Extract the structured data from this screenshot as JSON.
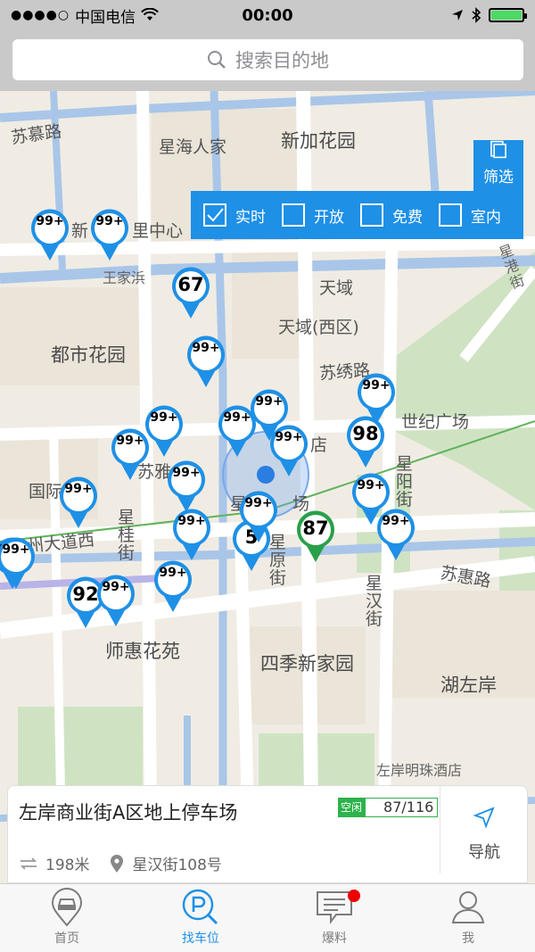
{
  "status_bar": {
    "carrier": "中国电信",
    "time": "00:00"
  },
  "search": {
    "placeholder": "搜索目的地"
  },
  "filter": {
    "button_label": "筛选",
    "options": [
      {
        "label": "实时",
        "checked": true
      },
      {
        "label": "开放",
        "checked": false
      },
      {
        "label": "免费",
        "checked": false
      },
      {
        "label": "室内",
        "checked": false
      }
    ]
  },
  "map_labels": {
    "sumu_road": "苏慕路",
    "xinghai": "星海人家",
    "xinjia": "新加花园",
    "xinli_center": "新",
    "xinli_center2": "里中心",
    "wangjiabang": "王家浜",
    "tianyu": "天域",
    "tianyu_west": "天域(西区)",
    "dushi": "都市花园",
    "suxiu_road": "苏绣路",
    "century_square": "世纪广场",
    "guoji": "国际",
    "suya": "苏雅",
    "xing_square": "星",
    "xing_square2": "场",
    "suzhou_ave": "州大道西",
    "xinggui_st": "星桂街",
    "xingyang_st": "星阳街",
    "xingyuan_st": "星原街",
    "suhui_road": "苏惠路",
    "xinghan_st": "星汉街",
    "shihui": "师惠花苑",
    "siji": "四季新家园",
    "huzuoan": "湖左岸",
    "hotel": "左岸明珠酒店",
    "dian": "店",
    "huxi": "湖",
    "xingang": "星港街",
    "zhong": "中"
  },
  "pins": [
    {
      "label": "99+",
      "color": "#1e90e6"
    },
    {
      "label": "99+",
      "color": "#1e90e6"
    },
    {
      "label": "67",
      "color": "#1e90e6"
    },
    {
      "label": "99+",
      "color": "#1e90e6"
    },
    {
      "label": "99+",
      "color": "#1e90e6"
    },
    {
      "label": "99+",
      "color": "#1e90e6"
    },
    {
      "label": "99+",
      "color": "#1e90e6"
    },
    {
      "label": "99+",
      "color": "#1e90e6"
    },
    {
      "label": "99+",
      "color": "#1e90e6"
    },
    {
      "label": "98",
      "color": "#1e90e6"
    },
    {
      "label": "99+",
      "color": "#1e90e6"
    },
    {
      "label": "99+",
      "color": "#1e90e6"
    },
    {
      "label": "99+",
      "color": "#1e90e6"
    },
    {
      "label": "99+",
      "color": "#1e90e6"
    },
    {
      "label": "99+",
      "color": "#1e90e6"
    },
    {
      "label": "5",
      "color": "#1e90e6"
    },
    {
      "label": "99+",
      "color": "#1e90e6"
    },
    {
      "label": "87",
      "color": "#2aa04a"
    },
    {
      "label": "99+",
      "color": "#1e90e6"
    },
    {
      "label": "99+",
      "color": "#1e90e6"
    },
    {
      "label": "99+",
      "color": "#1e90e6"
    },
    {
      "label": "92",
      "color": "#1e90e6"
    },
    {
      "label": "99+",
      "color": "#1e90e6"
    },
    {
      "label": "99+",
      "color": "#1e90e6"
    }
  ],
  "info_card": {
    "title": "左岸商业街A区地上停车场",
    "badge_tag": "空闲",
    "availability": "87/116",
    "distance": "198米",
    "address": "星汉街108号",
    "nav_label": "导航"
  },
  "tabs": [
    {
      "label": "首页",
      "active": false
    },
    {
      "label": "找车位",
      "active": true
    },
    {
      "label": "爆料",
      "active": false,
      "badge": true
    },
    {
      "label": "我",
      "active": false
    }
  ],
  "colors": {
    "accent": "#1e90e6",
    "green": "#2aa04a",
    "badge_red": "#e00000"
  }
}
